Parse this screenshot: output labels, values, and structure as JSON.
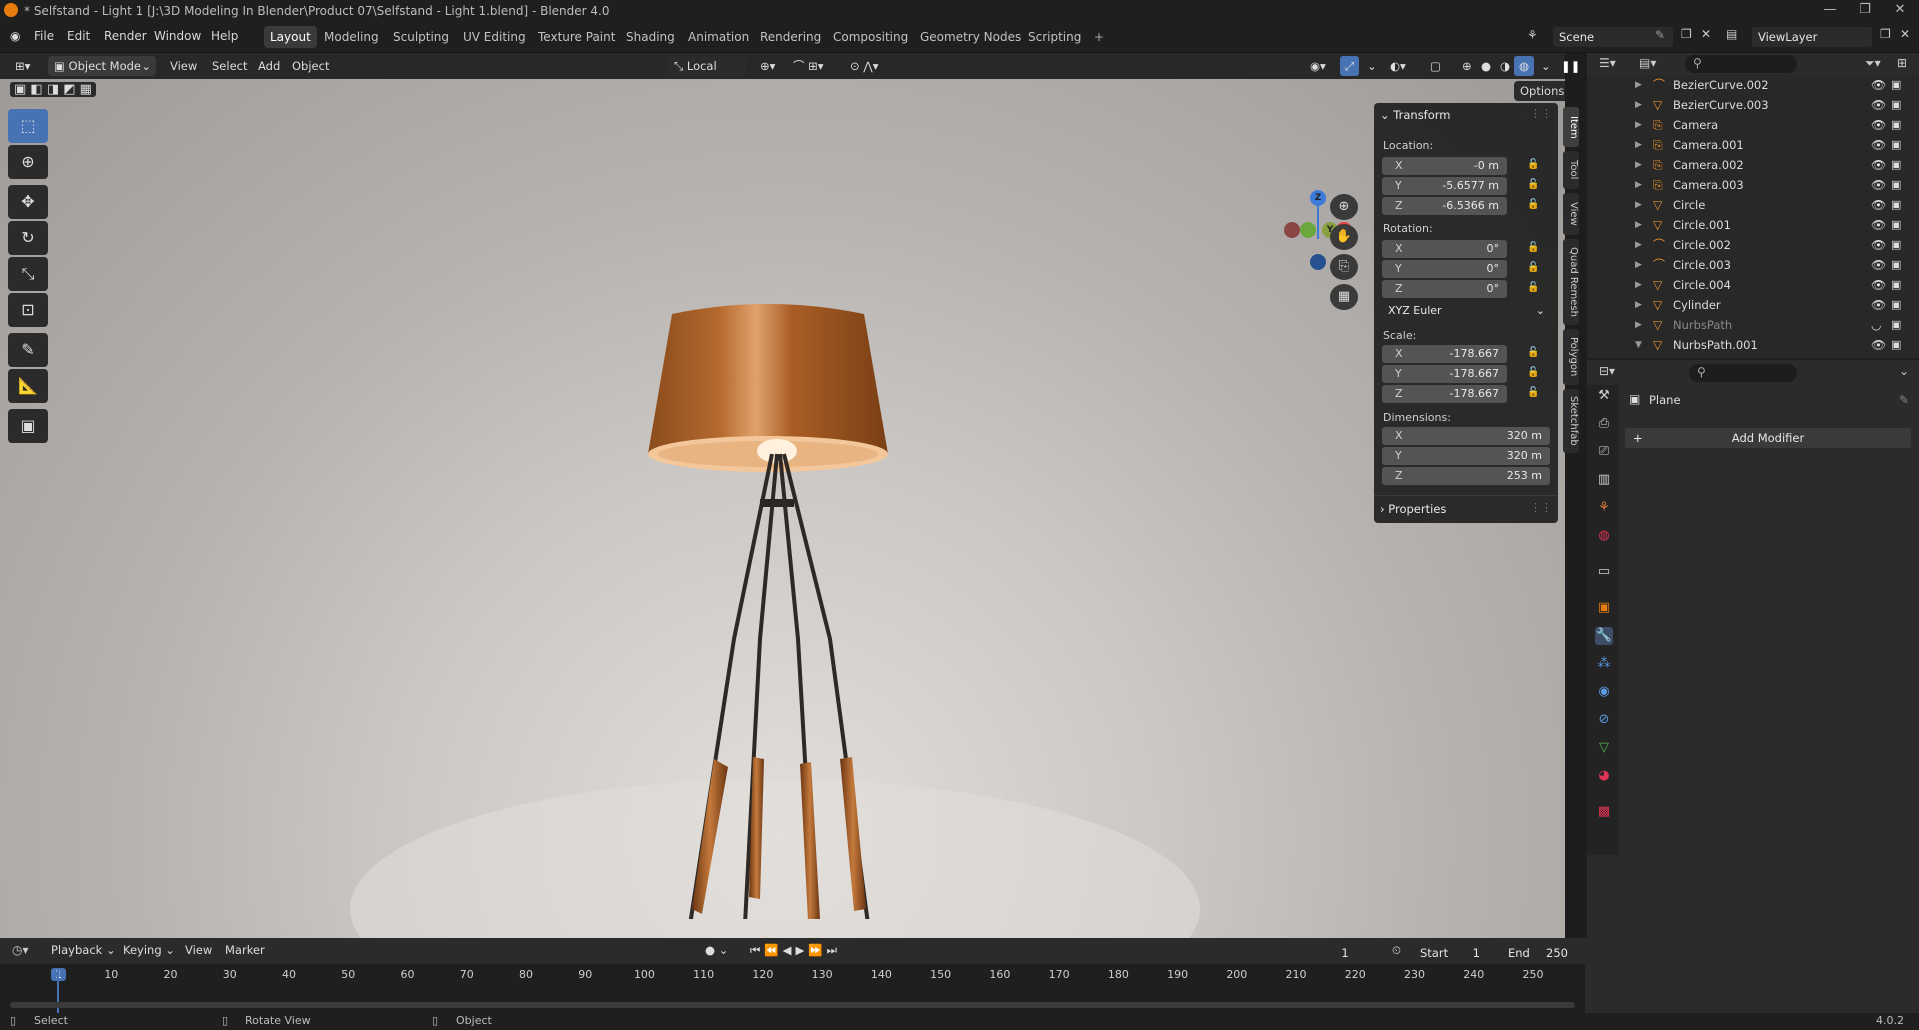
{
  "window": {
    "title": "* Selfstand - Light 1 [J:\\3D Modeling In Blender\\Product 07\\Selfstand - Light 1.blend] - Blender 4.0",
    "minimize": "—",
    "maximize": "❐",
    "close": "✕"
  },
  "menu": [
    "File",
    "Edit",
    "Render",
    "Window",
    "Help"
  ],
  "workspaces": [
    {
      "label": "Layout",
      "active": true
    },
    {
      "label": "Modeling"
    },
    {
      "label": "Sculpting"
    },
    {
      "label": "UV Editing"
    },
    {
      "label": "Texture Paint"
    },
    {
      "label": "Shading"
    },
    {
      "label": "Animation"
    },
    {
      "label": "Rendering"
    },
    {
      "label": "Compositing"
    },
    {
      "label": "Geometry Nodes"
    },
    {
      "label": "Scripting"
    }
  ],
  "add_workspace": "+",
  "scene": {
    "name": "Scene",
    "view_layer": "ViewLayer"
  },
  "viewport_header": {
    "mode": "Object Mode",
    "menus": [
      "View",
      "Select",
      "Add",
      "Object"
    ],
    "transform_orientation": "Local",
    "options": "Options"
  },
  "npanel": {
    "tabs": [
      "Item",
      "Tool",
      "View",
      "Quad Remesh",
      "Polygon",
      "Sketchfab"
    ],
    "transform": {
      "header": "Transform",
      "location_label": "Location:",
      "location": [
        {
          "axis": "X",
          "value": "-0 m"
        },
        {
          "axis": "Y",
          "value": "-5.6577 m"
        },
        {
          "axis": "Z",
          "value": "-6.5366 m"
        }
      ],
      "rotation_label": "Rotation:",
      "rotation": [
        {
          "axis": "X",
          "value": "0°"
        },
        {
          "axis": "Y",
          "value": "0°"
        },
        {
          "axis": "Z",
          "value": "0°"
        }
      ],
      "rotation_mode": "XYZ Euler",
      "scale_label": "Scale:",
      "scale": [
        {
          "axis": "X",
          "value": "-178.667"
        },
        {
          "axis": "Y",
          "value": "-178.667"
        },
        {
          "axis": "Z",
          "value": "-178.667"
        }
      ],
      "dimensions_label": "Dimensions:",
      "dimensions": [
        {
          "axis": "X",
          "value": "320 m"
        },
        {
          "axis": "Y",
          "value": "320 m"
        },
        {
          "axis": "Z",
          "value": "253 m"
        }
      ]
    },
    "properties_header": "Properties"
  },
  "gizmo": {
    "z": "Z",
    "y": "Y",
    "x": "X"
  },
  "outliner": [
    {
      "name": "BezierCurve.002",
      "icon": "curve"
    },
    {
      "name": "BezierCurve.003",
      "icon": "mesh"
    },
    {
      "name": "Camera",
      "icon": "camera"
    },
    {
      "name": "Camera.001",
      "icon": "camera"
    },
    {
      "name": "Camera.002",
      "icon": "camera"
    },
    {
      "name": "Camera.003",
      "icon": "camera"
    },
    {
      "name": "Circle",
      "icon": "mesh"
    },
    {
      "name": "Circle.001",
      "icon": "mesh"
    },
    {
      "name": "Circle.002",
      "icon": "curve"
    },
    {
      "name": "Circle.003",
      "icon": "curve"
    },
    {
      "name": "Circle.004",
      "icon": "mesh"
    },
    {
      "name": "Cylinder",
      "icon": "mesh"
    },
    {
      "name": "NurbsPath",
      "icon": "mesh",
      "dim": true
    },
    {
      "name": "NurbsPath.001",
      "icon": "mesh",
      "expanded": true
    },
    {
      "name": "NurbsPath.001",
      "icon": "mesh",
      "child": true
    }
  ],
  "properties": {
    "object_name": "Plane",
    "add_modifier": "Add Modifier"
  },
  "timeline": {
    "menus": [
      "Playback",
      "Keying",
      "View",
      "Marker"
    ],
    "current_frame": "1",
    "start_label": "Start",
    "start": "1",
    "end_label": "End",
    "end": "250",
    "ticks": [
      "1",
      "10",
      "20",
      "30",
      "40",
      "50",
      "60",
      "70",
      "80",
      "90",
      "100",
      "110",
      "120",
      "130",
      "140",
      "150",
      "160",
      "170",
      "180",
      "190",
      "200",
      "210",
      "220",
      "230",
      "240",
      "250"
    ]
  },
  "status": {
    "select": "Select",
    "rotate": "Rotate View",
    "object": "Object",
    "version": "4.0.2"
  },
  "colors": {
    "accent": "#4772b3",
    "orange": "#e87d0d",
    "x_axis": "#e84141",
    "y_axis": "#6aa83d",
    "z_axis": "#3c7bd8"
  }
}
